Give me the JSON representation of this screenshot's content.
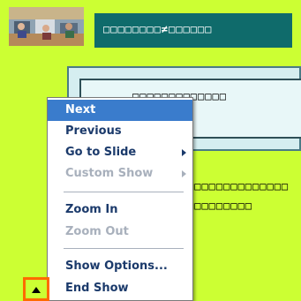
{
  "slide": {
    "title": "□□□□□□□□≠□□□□□□",
    "content_line1": "□□□□□□□□□□□□□",
    "content_line2": "□□□□□□□□",
    "body_line1": "□□□□□□□□□□□□□□",
    "body_line2": "□□□□□□□□□"
  },
  "context_menu": {
    "items": [
      {
        "label": "Next"
      },
      {
        "label": "Previous"
      },
      {
        "label": "Go to Slide"
      },
      {
        "label": "Custom Show"
      },
      {
        "label": "Zoom In"
      },
      {
        "label": "Zoom Out"
      },
      {
        "label": "Show Options..."
      },
      {
        "label": "End Show"
      }
    ]
  },
  "colors": {
    "background": "#ccff33",
    "title_band": "#0f6b6b",
    "menu_highlight": "#3a7ccc",
    "menu_text": "#1b3a6b",
    "menu_disabled": "#a8b0bc",
    "nav_button_border": "#ff6a00"
  },
  "icons": {
    "thumbnail": "classroom-photo",
    "nav_button": "up-triangle-icon",
    "submenu": "chevron-right-icon"
  }
}
